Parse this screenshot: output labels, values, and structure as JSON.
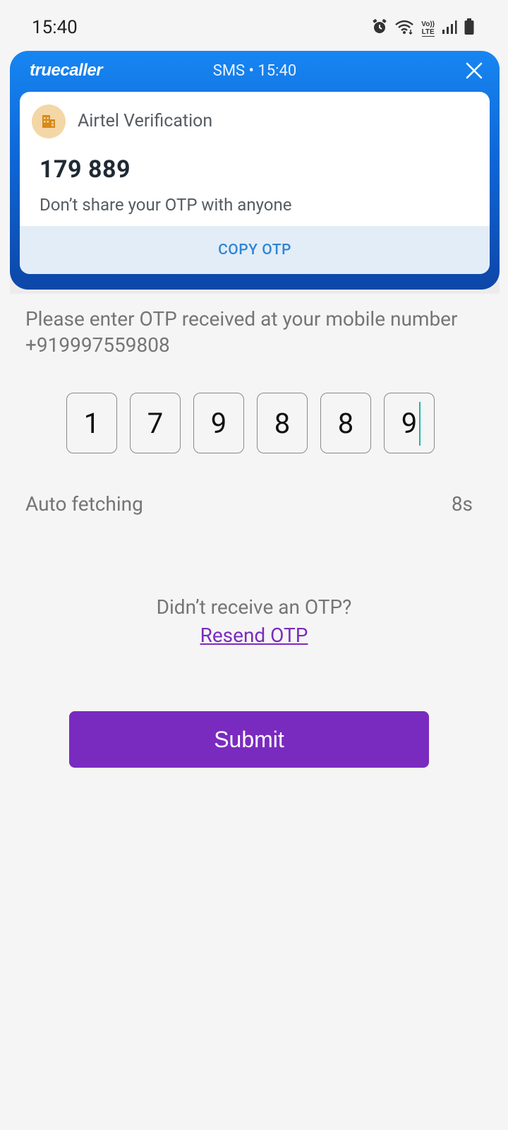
{
  "status_bar": {
    "time": "15:40",
    "icons": [
      "alarm-icon",
      "wifi-icon",
      "volte-lte-icon",
      "signal-icon",
      "battery-icon"
    ],
    "volte_text": "Vo))",
    "lte_text": "LTE"
  },
  "truecaller": {
    "brand": "truecaller",
    "meta": "SMS • 15:40",
    "sender": "Airtel Verification",
    "otp_display": "179 889",
    "message": "Don’t share your OTP with anyone",
    "copy_label": "COPY OTP",
    "colors": {
      "header": "#1786f2",
      "copy_bg": "#e3edf8",
      "copy_text": "#2f86d6",
      "avatar_bg": "#f4d7a6",
      "avatar_icon": "#d98a1a"
    }
  },
  "otp_page": {
    "prompt": "Please enter OTP received at your mobile number +919997559808",
    "digits": [
      "1",
      "7",
      "9",
      "8",
      "8",
      "9"
    ],
    "auto_fetch_label": "Auto fetching",
    "auto_fetch_timer": "8s",
    "didnt_receive": "Didn’t receive an OTP?",
    "resend_label": "Resend OTP",
    "submit_label": "Submit",
    "colors": {
      "primary": "#7a2bbf",
      "caret": "#18b8a8"
    }
  }
}
